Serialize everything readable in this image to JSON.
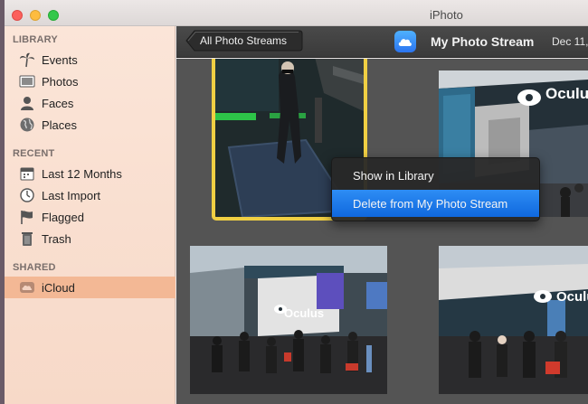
{
  "window": {
    "title": "iPhoto"
  },
  "sidebar": {
    "sections": [
      {
        "heading": "LIBRARY",
        "items": [
          {
            "label": "Events",
            "icon": "palm-tree-icon"
          },
          {
            "label": "Photos",
            "icon": "photos-icon"
          },
          {
            "label": "Faces",
            "icon": "faces-icon"
          },
          {
            "label": "Places",
            "icon": "globe-icon"
          }
        ]
      },
      {
        "heading": "RECENT",
        "items": [
          {
            "label": "Last 12 Months",
            "icon": "calendar-icon"
          },
          {
            "label": "Last Import",
            "icon": "clock-icon"
          },
          {
            "label": "Flagged",
            "icon": "flag-icon"
          },
          {
            "label": "Trash",
            "icon": "trash-icon"
          }
        ]
      },
      {
        "heading": "SHARED",
        "items": [
          {
            "label": "iCloud",
            "icon": "cloud-icon",
            "selected": true
          }
        ]
      }
    ]
  },
  "toolbar": {
    "back_label": "All Photo Streams",
    "stream_title": "My Photo Stream",
    "date": "Dec 11,"
  },
  "context_menu": {
    "items": [
      {
        "label": "Show in Library",
        "highlighted": false
      },
      {
        "label": "Delete from My Photo Stream",
        "highlighted": true
      }
    ]
  },
  "photo_text": {
    "brand": "Oculus"
  },
  "colors": {
    "selection_border": "#f0cf43",
    "menu_highlight": "#1d7ce8",
    "sidebar_selected": "#f3b895",
    "cloud_badge": "#3a8ff7"
  }
}
